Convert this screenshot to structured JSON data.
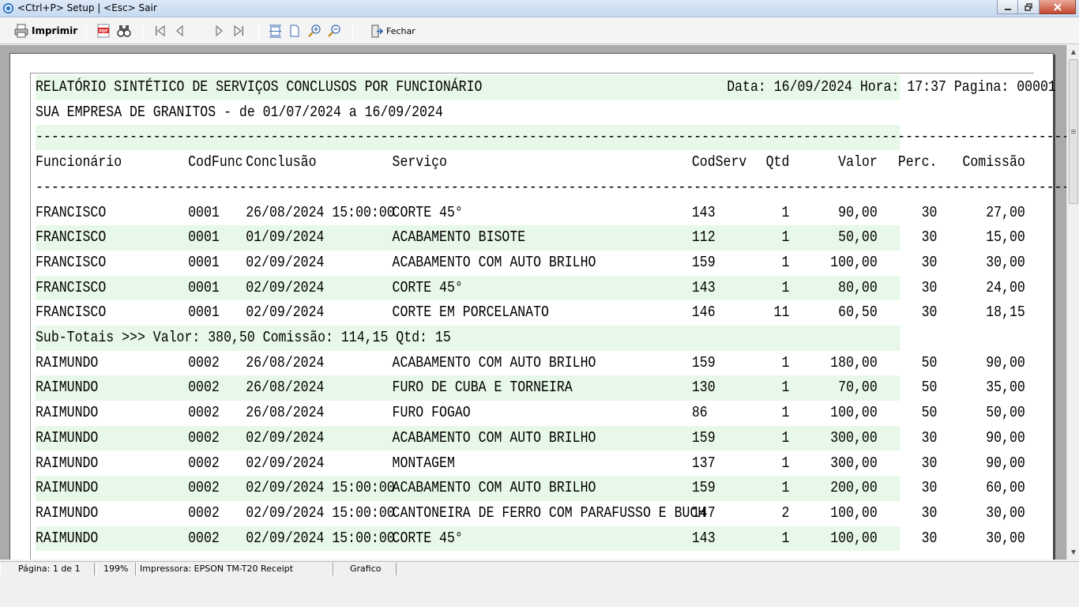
{
  "window": {
    "title": "<Ctrl+P> Setup | <Esc> Sair"
  },
  "toolbar": {
    "print_label": "Imprimir",
    "close_label": "Fechar"
  },
  "report": {
    "title": "RELATÓRIO SINTÉTICO DE SERVIÇOS CONCLUSOS POR FUNCIONÁRIO",
    "header_right": "Data: 16/09/2024 Hora: 17:37 Pagina: 00001",
    "company_line": "SUA EMPRESA DE GRANITOS - de 01/07/2024 a 16/09/2024",
    "dashes": "--------------------------------------------------------------------------------------------------------------------------------------------------------------",
    "columns": {
      "funcionario": "Funcionário",
      "codfunc": "CodFunc",
      "conclusao": "Conclusão",
      "servico": "Serviço",
      "codserv": "CodServ",
      "qtd": "Qtd",
      "valor": "Valor",
      "perc": "Perc.",
      "comissao": "Comissão"
    },
    "rows": [
      {
        "funcionario": "FRANCISCO",
        "codfunc": "0001",
        "conclusao": "26/08/2024 15:00:00",
        "servico": "CORTE 45°",
        "codserv": "143",
        "qtd": "1",
        "valor": "90,00",
        "perc": "30",
        "comissao": "27,00"
      },
      {
        "funcionario": "FRANCISCO",
        "codfunc": "0001",
        "conclusao": "01/09/2024",
        "servico": "ACABAMENTO BISOTE",
        "codserv": "112",
        "qtd": "1",
        "valor": "50,00",
        "perc": "30",
        "comissao": "15,00"
      },
      {
        "funcionario": "FRANCISCO",
        "codfunc": "0001",
        "conclusao": "02/09/2024",
        "servico": "ACABAMENTO COM AUTO BRILHO",
        "codserv": "159",
        "qtd": "1",
        "valor": "100,00",
        "perc": "30",
        "comissao": "30,00"
      },
      {
        "funcionario": "FRANCISCO",
        "codfunc": "0001",
        "conclusao": "02/09/2024",
        "servico": "CORTE 45°",
        "codserv": "143",
        "qtd": "1",
        "valor": "80,00",
        "perc": "30",
        "comissao": "24,00"
      },
      {
        "funcionario": "FRANCISCO",
        "codfunc": "0001",
        "conclusao": "02/09/2024",
        "servico": "CORTE EM PORCELANATO",
        "codserv": "146",
        "qtd": "11",
        "valor": "60,50",
        "perc": "30",
        "comissao": "18,15"
      }
    ],
    "subtotal": "Sub-Totais >>> Valor: 380,50 Comissão: 114,15 Qtd: 15",
    "rows2": [
      {
        "funcionario": "RAIMUNDO",
        "codfunc": "0002",
        "conclusao": "26/08/2024",
        "servico": "ACABAMENTO COM AUTO BRILHO",
        "codserv": "159",
        "qtd": "1",
        "valor": "180,00",
        "perc": "50",
        "comissao": "90,00"
      },
      {
        "funcionario": "RAIMUNDO",
        "codfunc": "0002",
        "conclusao": "26/08/2024",
        "servico": "FURO DE CUBA E TORNEIRA",
        "codserv": "130",
        "qtd": "1",
        "valor": "70,00",
        "perc": "50",
        "comissao": "35,00"
      },
      {
        "funcionario": "RAIMUNDO",
        "codfunc": "0002",
        "conclusao": "26/08/2024",
        "servico": "FURO FOGAO",
        "codserv": "86",
        "qtd": "1",
        "valor": "100,00",
        "perc": "50",
        "comissao": "50,00"
      },
      {
        "funcionario": "RAIMUNDO",
        "codfunc": "0002",
        "conclusao": "02/09/2024",
        "servico": "ACABAMENTO COM AUTO BRILHO",
        "codserv": "159",
        "qtd": "1",
        "valor": "300,00",
        "perc": "30",
        "comissao": "90,00"
      },
      {
        "funcionario": "RAIMUNDO",
        "codfunc": "0002",
        "conclusao": "02/09/2024",
        "servico": "MONTAGEM",
        "codserv": "137",
        "qtd": "1",
        "valor": "300,00",
        "perc": "30",
        "comissao": "90,00"
      },
      {
        "funcionario": "RAIMUNDO",
        "codfunc": "0002",
        "conclusao": "02/09/2024 15:00:00",
        "servico": "ACABAMENTO COM AUTO BRILHO",
        "codserv": "159",
        "qtd": "1",
        "valor": "200,00",
        "perc": "30",
        "comissao": "60,00"
      },
      {
        "funcionario": "RAIMUNDO",
        "codfunc": "0002",
        "conclusao": "02/09/2024 15:00:00",
        "servico": "CANTONEIRA DE FERRO COM PARAFUSSO E BUCH",
        "codserv": "147",
        "qtd": "2",
        "valor": "100,00",
        "perc": "30",
        "comissao": "30,00"
      },
      {
        "funcionario": "RAIMUNDO",
        "codfunc": "0002",
        "conclusao": "02/09/2024 15:00:00",
        "servico": "CORTE 45°",
        "codserv": "143",
        "qtd": "1",
        "valor": "100,00",
        "perc": "30",
        "comissao": "30,00"
      }
    ]
  },
  "status": {
    "page": "Página: 1 de 1",
    "zoom": "199%",
    "printer": "Impressora: EPSON TM-T20 Receipt",
    "mode": "Grafico"
  },
  "colors": {
    "row_highlight": "#e8f8e8",
    "preview_bg": "#ababab"
  }
}
